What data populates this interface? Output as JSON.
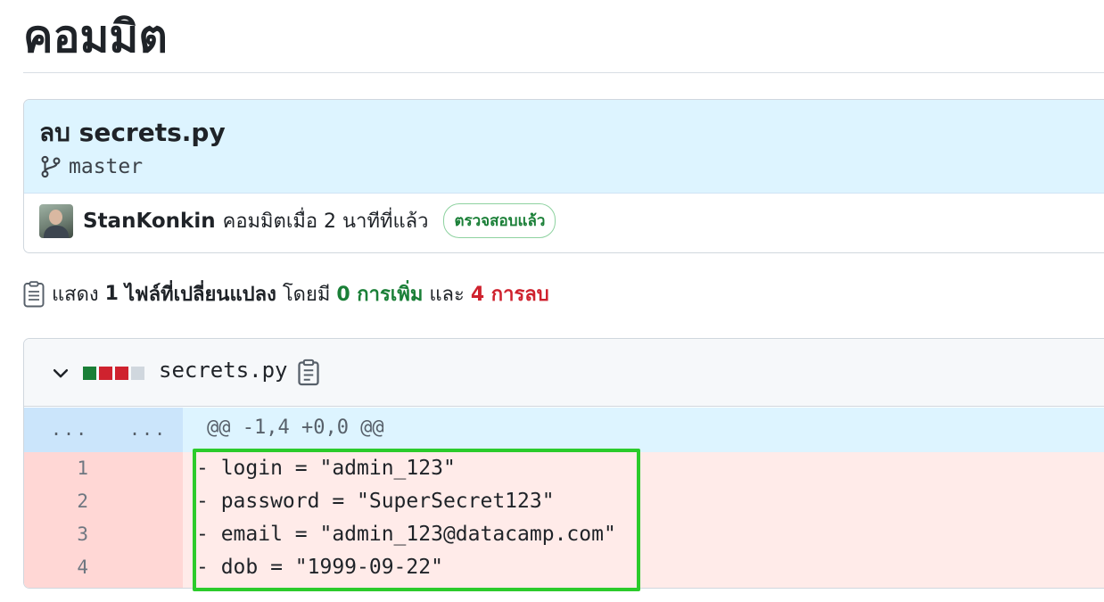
{
  "page": {
    "title": "คอมมิต"
  },
  "commit": {
    "message": "ลบ secrets.py",
    "branch": "master",
    "author": "StanKonkin",
    "committed_text": "คอมมิตเมื่อ 2 นาทีที่แล้ว",
    "verified_label": "ตรวจสอบแล้ว"
  },
  "summary": {
    "prefix": "แสดง",
    "files_count": "1",
    "files_label": "ไฟล์ที่เปลี่ยนแปลง",
    "middle": "โดยมี",
    "additions": "0 การเพิ่ม",
    "conjunction": "และ",
    "deletions": "4 การลบ"
  },
  "file": {
    "name": "secrets.py",
    "hunk_dots_left": "...",
    "hunk_dots_right": "...",
    "hunk_header": "@@ -1,4 +0,0 @@",
    "lines": [
      {
        "number": "1",
        "code": "- login = \"admin_123\""
      },
      {
        "number": "2",
        "code": "- password = \"SuperSecret123\""
      },
      {
        "number": "3",
        "code": "- email = \"admin_123@datacamp.com\""
      },
      {
        "number": "4",
        "code": "- dob = \"1999-09-22\""
      }
    ]
  },
  "colors": {
    "addition": "#1a7f37",
    "deletion": "#cf222e",
    "highlight": "#2bcb2b",
    "hunk_bg": "#ddf4ff",
    "deletion_bg": "#ffebe9"
  },
  "icons": {
    "branch": "git-branch-icon",
    "file_diff": "file-diff-icon",
    "chevron": "chevron-down-icon",
    "copy": "copy-icon"
  }
}
